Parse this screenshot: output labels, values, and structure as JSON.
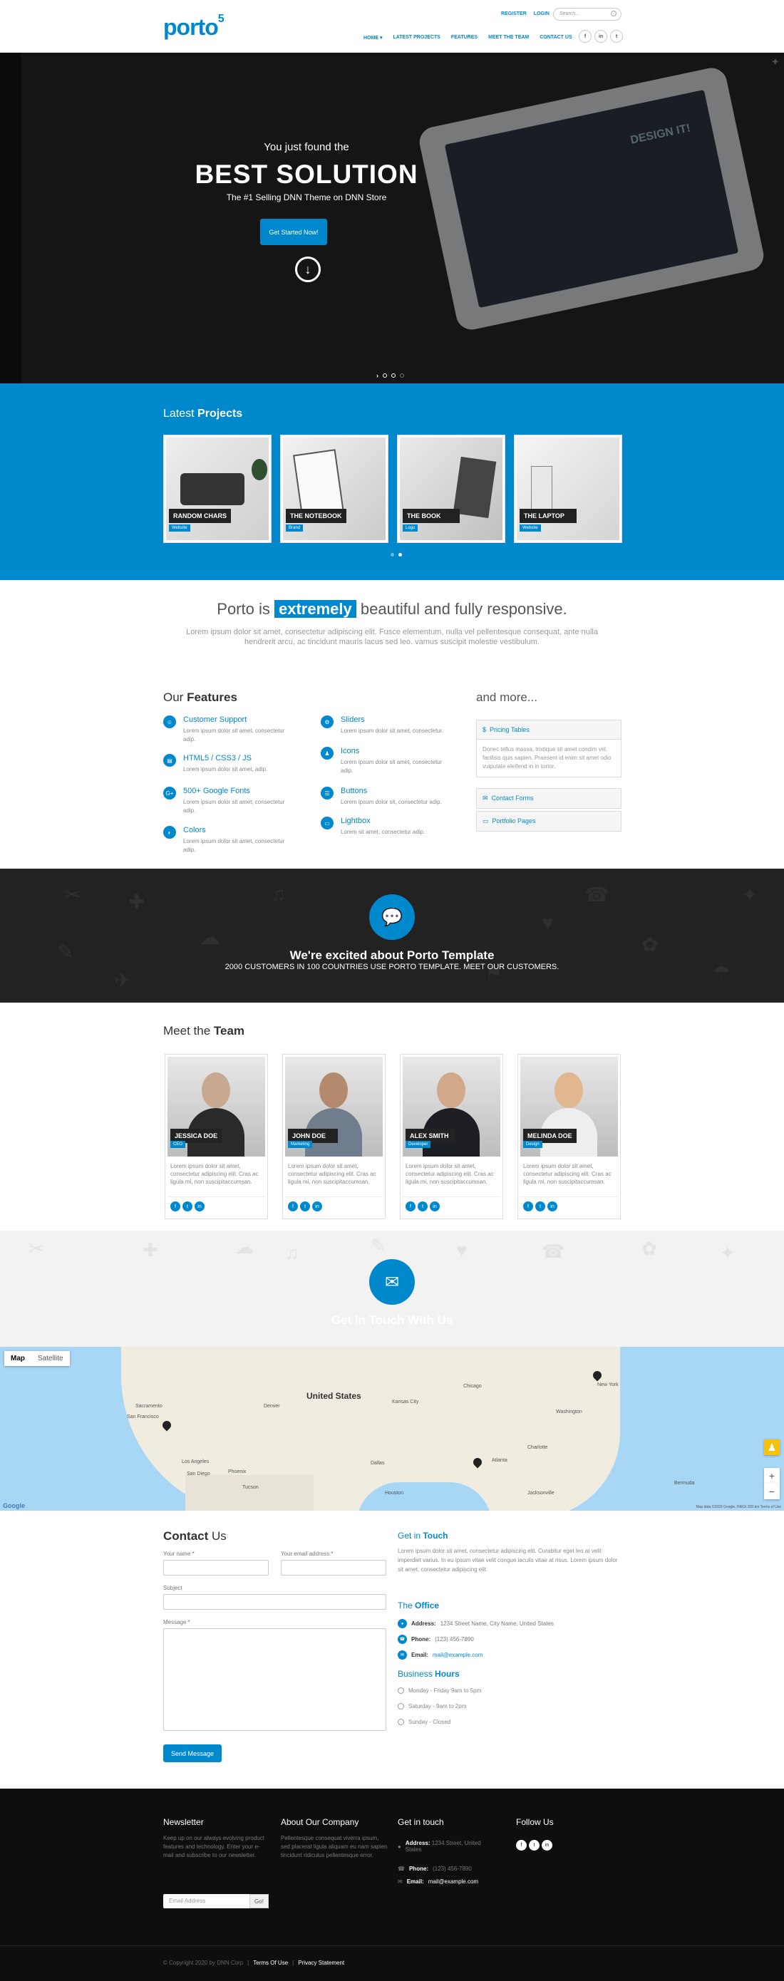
{
  "header": {
    "logo": "porto",
    "logo_sup": "5",
    "top_links": [
      "REGISTER",
      "LOGIN"
    ],
    "search_placeholder": "Search...",
    "nav": [
      "HOME ▾",
      "LATEST PROJECTS",
      "FEATURES",
      "MEET THE TEAM",
      "CONTACT US"
    ],
    "social": [
      "f",
      "in",
      "t"
    ]
  },
  "hero": {
    "line1": "You just found the",
    "line2": "BEST SOLUTION",
    "line3": "The #1 Selling DNN Theme on DNN Store",
    "button": "Get Started Now!",
    "tablet_text": "DESIGN IT!"
  },
  "projects": {
    "title_light": "Latest",
    "title_bold": "Projects",
    "items": [
      {
        "name": "RANDOM CHARS",
        "tag": "Website"
      },
      {
        "name": "THE NOTEBOOK",
        "tag": "Brand"
      },
      {
        "name": "THE BOOK",
        "tag": "Logo"
      },
      {
        "name": "THE LAPTOP",
        "tag": "Website"
      }
    ]
  },
  "tagline": {
    "pre": "Porto is",
    "highlight": "extremely",
    "post": "beautiful and fully responsive.",
    "text": "Lorem ipsum dolor sit amet, consectetur adipiscing elit. Fusce elementum, nulla vel pellentesque consequat, ante nulla hendrerit arcu, ac tincidunt mauris lacus sed leo. vamus suscipit molestie vestibulum."
  },
  "features": {
    "title_light": "Our",
    "title_bold": "Features",
    "items": [
      {
        "title": "Customer Support",
        "text": "Lorem ipsum dolor sit amet, consectetur adip."
      },
      {
        "title": "HTML5 / CSS3 / JS",
        "text": "Lorem ipsum dolor sit amet, adip."
      },
      {
        "title": "500+ Google Fonts",
        "text": "Lorem ipsum dolor sit amet, consectetur adip."
      },
      {
        "title": "Colors",
        "text": "Lorem ipsum dolor sit amet, consectetur adip."
      },
      {
        "title": "Sliders",
        "text": "Lorem ipsum dolor sit amet, consectetur."
      },
      {
        "title": "Icons",
        "text": "Lorem ipsum dolor sit amet, consectetur adip."
      },
      {
        "title": "Buttons",
        "text": "Lorem ipsum dolor sit, consectetur adip."
      },
      {
        "title": "Lightbox",
        "text": "Lorem sit amet, consectetur adip."
      }
    ],
    "more_title": "and more...",
    "accordion": [
      {
        "title": "Pricing Tables",
        "body": "Donec tellus massa, tristique sit amet condim vel, facilisis quis sapien. Praesent id enim sit amet odio vulputate eleifend in in tortor."
      },
      {
        "title": "Contact Forms"
      },
      {
        "title": "Portfolio Pages"
      }
    ]
  },
  "excited": {
    "title": "We're excited about Porto Template",
    "subtitle": "2000 CUSTOMERS IN 100 COUNTRIES USE PORTO TEMPLATE. MEET OUR CUSTOMERS."
  },
  "team": {
    "title_light": "Meet the",
    "title_bold": "Team",
    "members": [
      {
        "name": "JESSICA DOE",
        "role": "CEO",
        "text": "Lorem ipsum dolor sit amet, consectetur adipiscing elit. Cras ac ligula mi, non suscipitaccumsan."
      },
      {
        "name": "JOHN DOE",
        "role": "Marketing",
        "text": "Lorem ipsum dolor sit amet, consectetur adipiscing elit. Cras ac ligula mi, non suscipitaccumsan."
      },
      {
        "name": "ALEX SMITH",
        "role": "Developer",
        "text": "Lorem ipsum dolor sit amet, consectetur adipiscing elit. Cras ac ligula mi, non suscipitaccumsan."
      },
      {
        "name": "MELINDA DOE",
        "role": "Design",
        "text": "Lorem ipsum dolor sit amet, consectetur adipiscing elit. Cras ac ligula mi, non suscipitaccumsan."
      }
    ]
  },
  "getintouch": {
    "title": "Get in Touch With Us"
  },
  "map": {
    "type_map": "Map",
    "type_satellite": "Satellite",
    "country": "United States",
    "google": "Google",
    "credits": "Map data ©2020 Google, INEGI  200 km  Terms of Use",
    "cities": [
      "Sacramento",
      "San Francisco",
      "Los Angeles",
      "San Diego",
      "Phoenix",
      "Tucson",
      "Kansas City",
      "Chicago",
      "Atlanta",
      "Charlotte",
      "Washington",
      "New York",
      "Jacksonville",
      "Bermuda",
      "Dallas",
      "Houston",
      "Denver"
    ]
  },
  "contact": {
    "title_bold": "Contact",
    "title_light": "Us",
    "name_label": "Your name *",
    "email_label": "Your email address *",
    "subject_label": "Subject",
    "message_label": "Message *",
    "send": "Send Message",
    "git_light": "Get in",
    "git_bold": "Touch",
    "git_text": "Lorem ipsum dolor sit amet, consectetur adipiscing elit. Curabitur eget leo at velit imperdiet varius. In eu ipsum vitae velit congue iaculis vitae at risus. Lorem ipsum dolor sit amet, consectetur adipiscing elit.",
    "office_light": "The",
    "office_bold": "Office",
    "address_label": "Address:",
    "address": "1234 Street Name, City Name, United States",
    "phone_label": "Phone:",
    "phone": "(123) 456-7890",
    "email_label2": "Email:",
    "email": "mail@example.com",
    "hours_light": "Business",
    "hours_bold": "Hours",
    "hours": [
      "Monday - Friday 9am to 5pm",
      "Saturday - 9am to 2pm",
      "Sunday - Closed"
    ]
  },
  "footer": {
    "newsletter_title": "Newsletter",
    "newsletter_text": "Keep up on our always evolving product features and technology. Enter your e-mail and subscribe to our newsletter.",
    "email_placeholder": "Email Address",
    "go": "Go!",
    "about_title": "About Our Company",
    "about_text": "Pellentesque consequat viverra ipsum, sed placerat ligula aliquam eu nam sapien tincidunt ridiculus pellentesque error.",
    "touch_title": "Get in touch",
    "address_label": "Address:",
    "address": "1234 Street, United States",
    "phone_label": "Phone:",
    "phone": "(123) 456-7890",
    "email_label": "Email:",
    "email": "mail@example.com",
    "follow_title": "Follow Us",
    "copyright": "© Copyright 2020 by DNN Corp",
    "terms": "Terms Of Use",
    "privacy": "Privacy Statement"
  }
}
